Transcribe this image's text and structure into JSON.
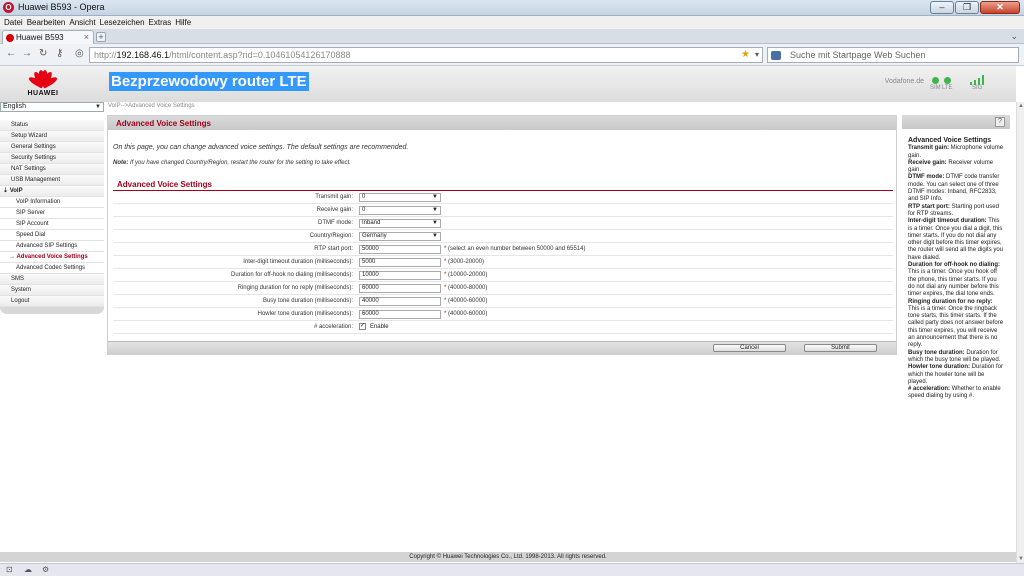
{
  "window": {
    "title": "Huawei B593 - Opera"
  },
  "menu": [
    "Datei",
    "Bearbeiten",
    "Ansicht",
    "Lesezeichen",
    "Extras",
    "Hilfe"
  ],
  "tab": {
    "label": "Huawei B593"
  },
  "address": {
    "host": "192.168.46.1",
    "path": "/html/content.asp?rid=0.10461054126170888",
    "prefix": "http://"
  },
  "search": {
    "placeholder": "Suche mit Startpage Web Suchen"
  },
  "header": {
    "brand": "HUAWEI",
    "title": "Bezprzewodowy router LTE",
    "operator": "Vodafone.de",
    "sim_label": "SIM",
    "lte_label": "LTE",
    "sig_label": "SIG",
    "signal_bars": 4
  },
  "language": "English",
  "breadcrumb": "VoIP-->Advanced Voice Settings",
  "sidebar": [
    {
      "label": "Status",
      "kind": "top"
    },
    {
      "label": "Setup Wizard",
      "kind": "top"
    },
    {
      "label": "General Settings",
      "kind": "top"
    },
    {
      "label": "Security Settings",
      "kind": "top"
    },
    {
      "label": "NAT Settings",
      "kind": "top"
    },
    {
      "label": "USB Management",
      "kind": "top"
    },
    {
      "label": "VoIP",
      "kind": "open"
    },
    {
      "label": "VoIP Information",
      "kind": "sub"
    },
    {
      "label": "SIP Server",
      "kind": "sub"
    },
    {
      "label": "SIP Account",
      "kind": "sub"
    },
    {
      "label": "Speed Dial",
      "kind": "sub"
    },
    {
      "label": "Advanced SIP Settings",
      "kind": "sub"
    },
    {
      "label": "Advanced Voice Settings",
      "kind": "active"
    },
    {
      "label": "Advanced Codec Settings",
      "kind": "sub"
    },
    {
      "label": "SMS",
      "kind": "top"
    },
    {
      "label": "System",
      "kind": "top"
    },
    {
      "label": "Logout",
      "kind": "top"
    }
  ],
  "main": {
    "heading": "Advanced Voice Settings",
    "intro": "On this page, you can change advanced voice settings. The default settings are recommended.",
    "note_label": "Note:",
    "note_text": " If you have changed Country/Region, restart the router for the setting to take effect.",
    "section_title": "Advanced Voice Settings",
    "fields": [
      {
        "label": "Transmit gain:",
        "type": "select",
        "value": "0"
      },
      {
        "label": "Receive gain:",
        "type": "select",
        "value": "0"
      },
      {
        "label": "DTMF mode:",
        "type": "select",
        "value": "Inband"
      },
      {
        "label": "Country/Region:",
        "type": "select",
        "value": "Germany"
      },
      {
        "label": "RTP start port:",
        "type": "input",
        "value": "50000",
        "hint": "(select an even number between 50000 and 65514)"
      },
      {
        "label": "Inter-digit timeout duration (milliseconds):",
        "type": "input",
        "value": "5000",
        "hint": "(3000-20000)"
      },
      {
        "label": "Duration for off-hook no dialing (milliseconds):",
        "type": "input",
        "value": "10000",
        "hint": "(10000-20000)"
      },
      {
        "label": "Ringing duration for no reply (milliseconds):",
        "type": "input",
        "value": "60000",
        "hint": "(40000-80000)"
      },
      {
        "label": "Busy tone duration (milliseconds):",
        "type": "input",
        "value": "40000",
        "hint": "(40000-60000)"
      },
      {
        "label": "Howler tone duration (milliseconds):",
        "type": "input",
        "value": "60000",
        "hint": "(40000-60000)"
      },
      {
        "label": "# acceleration:",
        "type": "checkbox",
        "value": "Enable",
        "checked": true
      }
    ],
    "required_mark": "*",
    "cancel_label": "Cancel",
    "submit_label": "Submit"
  },
  "help": {
    "title": "Advanced Voice Settings",
    "items": [
      {
        "term": "Transmit gain:",
        "text": " Microphone volume gain."
      },
      {
        "term": "Receive gain:",
        "text": " Receiver volume gain."
      },
      {
        "term": "DTMF mode:",
        "text": " DTMF code transfer mode. You can select one of three DTMF modes: Inband, RFC2833, and SIP Info."
      },
      {
        "term": "RTP start port:",
        "text": " Starting port used for RTP streams."
      },
      {
        "term": "Inter-digit timeout duration:",
        "text": " This is a timer. Once you dial a digit, this timer starts. If you do not dial any other digit before this timer expires, the router will send all the digits you have dialed."
      },
      {
        "term": "Duration for off-hook no dialing:",
        "text": " This is a timer. Once you hook off the phone, this timer starts. If you do not dial any number before this timer expires, the dial tone ends."
      },
      {
        "term": "Ringing duration for no reply:",
        "text": " This is a timer. Once the ringback tone starts, this timer starts. If the called party does not answer before this timer expires, you will receive an announcement that there is no reply."
      },
      {
        "term": "Busy tone duration:",
        "text": " Duration for which the busy tone will be played."
      },
      {
        "term": "Howler tone duration:",
        "text": " Duration for which the howler tone will be played."
      },
      {
        "term": "# acceleration:",
        "text": " Whether to enable speed dialing by using #."
      }
    ]
  },
  "footer": {
    "copyright": "Copyright © Huawei Technologies Co., Ltd. 1998-2013. All rights reserved."
  },
  "colors": {
    "accent": "#a3001b",
    "brand": "#e60012",
    "highlight": "#3399ff",
    "ok": "#3cb54a"
  }
}
